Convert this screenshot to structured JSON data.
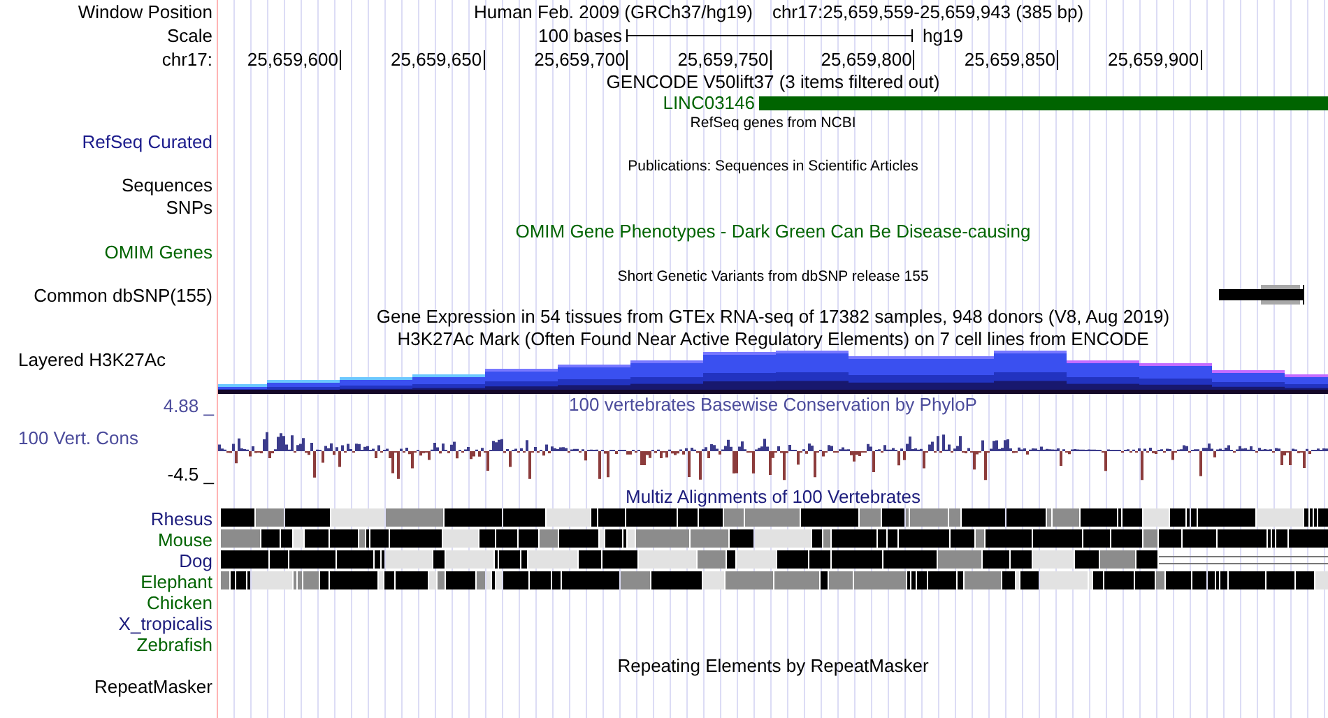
{
  "header": {
    "window_label": "Window Position",
    "assembly": "Human Feb. 2009 (GRCh37/hg19)",
    "position": "chr17:25,659,559-25,659,943 (385 bp)",
    "scale_label": "Scale",
    "scale_text": "100 bases",
    "scale_assembly": "hg19",
    "chrom_label": "chr17:",
    "ticks": [
      "25,659,600",
      "25,659,650",
      "25,659,700",
      "25,659,750",
      "25,659,800",
      "25,659,850",
      "25,659,900"
    ]
  },
  "rows": [
    {
      "kind": "title",
      "text": "GENCODE V50lift37 (3 items filtered out)",
      "color": "#000000"
    },
    {
      "kind": "gene",
      "name": "LINC03146",
      "color": "#006400"
    },
    {
      "kind": "subtitle",
      "text": "RefSeq genes from NCBI"
    },
    {
      "kind": "label",
      "label": "RefSeq Curated",
      "color": "#1c1c8c"
    },
    {
      "kind": "subtitle",
      "text": "Publications: Sequences in Scientific Articles"
    },
    {
      "kind": "label",
      "label": "Sequences",
      "color": "#000000"
    },
    {
      "kind": "label",
      "label": "SNPs",
      "color": "#000000"
    },
    {
      "kind": "title",
      "text": "OMIM Gene Phenotypes - Dark Green Can Be Disease-causing",
      "color": "#006400"
    },
    {
      "kind": "label",
      "label": "OMIM Genes",
      "color": "#006400"
    },
    {
      "kind": "subtitle",
      "text": "Short Genetic Variants from dbSNP release 155"
    },
    {
      "kind": "snp",
      "label": "Common dbSNP(155)",
      "color": "#000000"
    },
    {
      "kind": "title",
      "text": "Gene Expression in 54 tissues from GTEx RNA-seq of 17382 samples, 948 donors (V8, Aug 2019)",
      "color": "#000000"
    },
    {
      "kind": "title",
      "text": "H3K27Ac Mark (Often Found Near Active Regulatory Elements) on 7 cell lines from ENCODE",
      "color": "#000000"
    },
    {
      "kind": "layered",
      "label": "Layered H3K27Ac",
      "color": "#000000"
    },
    {
      "kind": "wiggle",
      "label": "100 Vert. Cons",
      "title": "100 vertebrates Basewise Conservation by PhyloP",
      "max": "4.88 _",
      "min": "-4.5 _",
      "color": "#4b4b9b"
    },
    {
      "kind": "title",
      "text": "Multiz Alignments of 100 Vertebrates",
      "color": "#1c1c7c"
    },
    {
      "kind": "species",
      "label": "Rhesus",
      "color": "#1c1c7c",
      "aligned": true
    },
    {
      "kind": "species",
      "label": "Mouse",
      "color": "#006400",
      "aligned": true
    },
    {
      "kind": "species",
      "label": "Dog",
      "color": "#1c1c7c",
      "aligned": true,
      "ends_in_gap": true
    },
    {
      "kind": "species",
      "label": "Elephant",
      "color": "#006400",
      "aligned": true
    },
    {
      "kind": "species",
      "label": "Chicken",
      "color": "#006400",
      "aligned": false
    },
    {
      "kind": "species",
      "label": "X_tropicalis",
      "color": "#1c1c7c",
      "aligned": false
    },
    {
      "kind": "species",
      "label": "Zebrafish",
      "color": "#006400",
      "aligned": false
    },
    {
      "kind": "title",
      "text": "Repeating Elements by RepeatMasker",
      "color": "#000000"
    },
    {
      "kind": "last",
      "label": "RepeatMasker",
      "color": "#000000"
    }
  ]
}
